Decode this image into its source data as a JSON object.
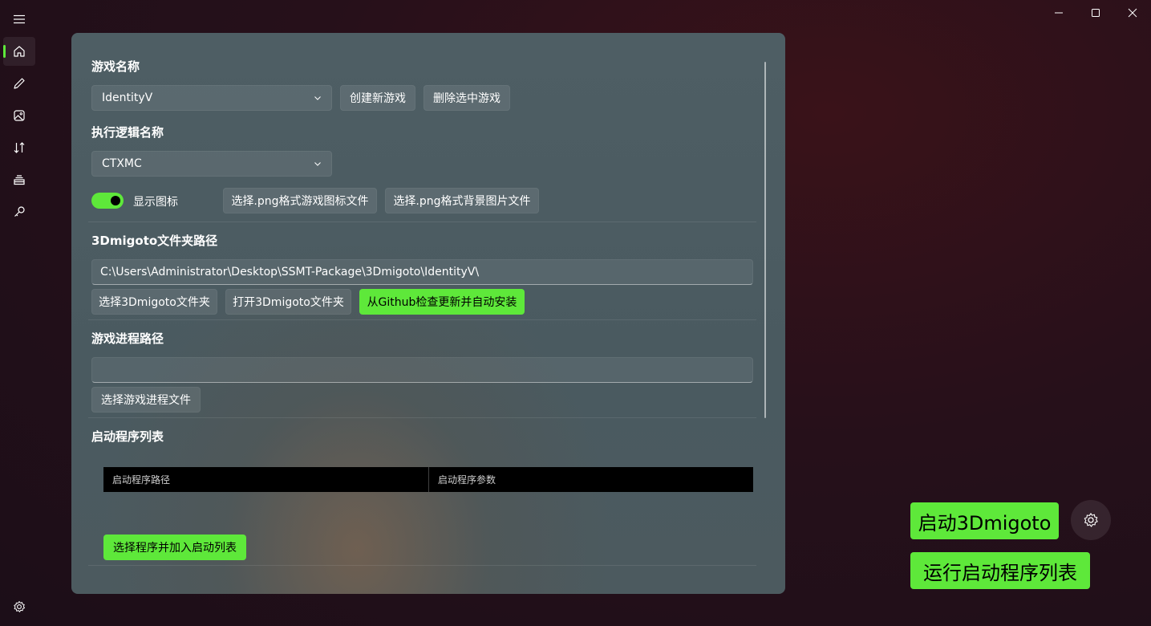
{
  "window": {
    "controls": [
      "minimize-icon",
      "maximize-icon",
      "close-icon"
    ]
  },
  "nav": {
    "items": [
      {
        "name": "home",
        "icon": "home-icon",
        "active": true
      },
      {
        "name": "edit",
        "icon": "pencil-icon"
      },
      {
        "name": "image",
        "icon": "image-icon"
      },
      {
        "name": "sort",
        "icon": "sort-icon"
      },
      {
        "name": "tray",
        "icon": "tray-icon"
      },
      {
        "name": "tools",
        "icon": "wrench-icon"
      }
    ],
    "footer_icon": "settings-icon",
    "accent_color": "#5ee83a"
  },
  "game": {
    "label": "游戏名称",
    "selected": "IdentityV",
    "create_button": "创建新游戏",
    "delete_button": "删除选中游戏"
  },
  "logic": {
    "label": "执行逻辑名称",
    "selected": "CTXMC"
  },
  "icon_toggle": {
    "label": "显示图标",
    "on": true,
    "select_icon_button": "选择.png格式游戏图标文件",
    "select_bg_button": "选择.png格式背景图片文件"
  },
  "migoto": {
    "label": "3Dmigoto文件夹路径",
    "path": "C:\\Users\\Administrator\\Desktop\\SSMT-Package\\3Dmigoto\\IdentityV\\",
    "select_button": "选择3Dmigoto文件夹",
    "open_button": "打开3Dmigoto文件夹",
    "update_button": "从Github检查更新并自动安装"
  },
  "process": {
    "label": "游戏进程路径",
    "path": "",
    "select_button": "选择游戏进程文件"
  },
  "launch_list": {
    "label": "启动程序列表",
    "columns": [
      "启动程序路径",
      "启动程序参数"
    ],
    "rows": [],
    "add_button": "选择程序并加入启动列表"
  },
  "actions": {
    "start_migoto": "启动3Dmigoto",
    "run_launch_list": "运行启动程序列表",
    "settings_icon": "settings-icon"
  },
  "colors": {
    "accent": "#5ee83a"
  }
}
